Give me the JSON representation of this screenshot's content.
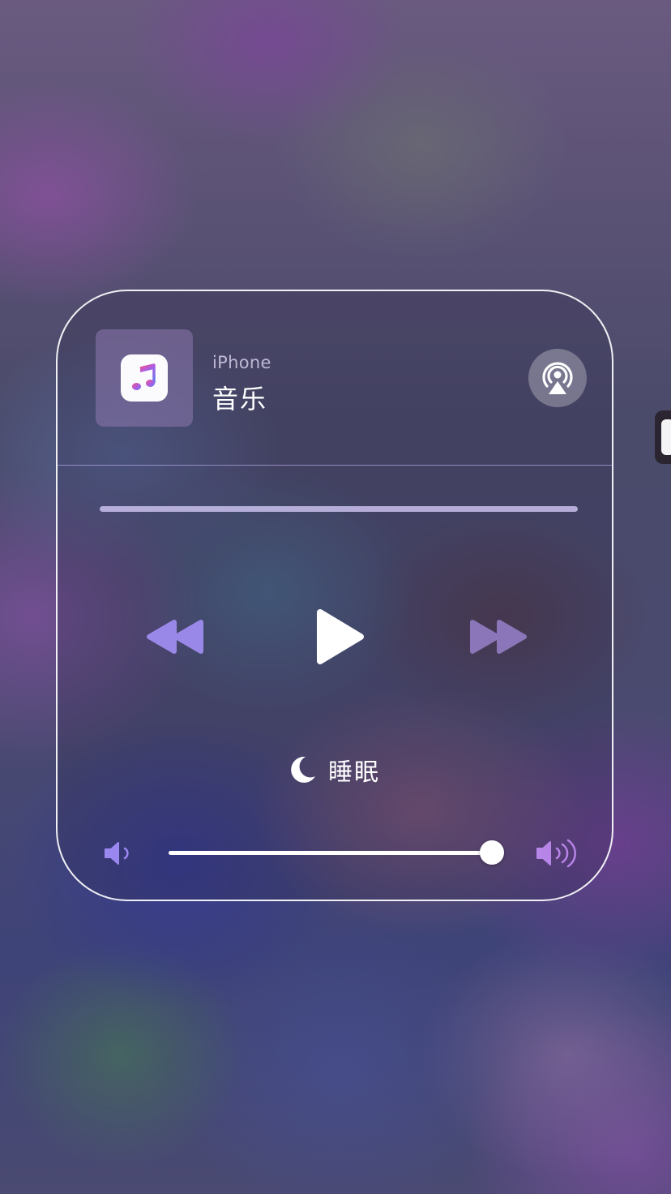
{
  "now_playing": {
    "source": "iPhone",
    "title": "音乐",
    "app_icon": "apple-music-icon",
    "airplay_icon": "airplay-audio-icon"
  },
  "playback": {
    "progress": 0.0,
    "controls": [
      "rewind-icon",
      "play-icon",
      "fast-forward-icon"
    ]
  },
  "sleep_timer": {
    "icon": "moon-icon",
    "label": "睡眠"
  },
  "volume": {
    "level": 0.97,
    "low_icon": "speaker-low-icon",
    "high_icon": "speaker-high-icon"
  },
  "colors": {
    "accent_purple": "#9a88e8",
    "forward_muted": "#8a76b8",
    "card_border": "#ffffff"
  }
}
